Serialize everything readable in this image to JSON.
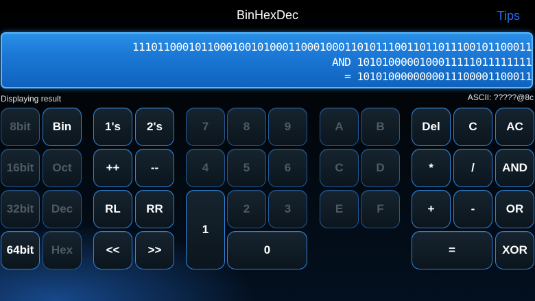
{
  "header": {
    "title": "BinHexDec",
    "tips_label": "Tips"
  },
  "display": {
    "line1": "1110110001011000100101000110001000110101110011011011100101100011",
    "line2": "AND 1010100000100011111011111111",
    "line3": "= 1010100000000011100001100011"
  },
  "status": {
    "text": "Displaying result",
    "ascii": "ASCII: ?????@8c"
  },
  "keys": {
    "bit8": "8bit",
    "bin": "Bin",
    "ones": "1's",
    "twos": "2's",
    "k7": "7",
    "k8": "8",
    "k9": "9",
    "kA": "A",
    "kB": "B",
    "del": "Del",
    "c": "C",
    "ac": "AC",
    "bit16": "16bit",
    "oct": "Oct",
    "inc": "++",
    "dec_op": "--",
    "k4": "4",
    "k5": "5",
    "k6": "6",
    "kC": "C",
    "kD": "D",
    "mul": "*",
    "div": "/",
    "and": "AND",
    "bit32": "32bit",
    "dec": "Dec",
    "rl": "RL",
    "rr": "RR",
    "k1": "1",
    "k2": "2",
    "k3": "3",
    "kE": "E",
    "kF": "F",
    "plus": "+",
    "minus": "-",
    "or": "OR",
    "bit64": "64bit",
    "hex": "Hex",
    "shl": "<<",
    "shr": ">>",
    "k0": "0",
    "eq": "=",
    "xor": "XOR"
  }
}
